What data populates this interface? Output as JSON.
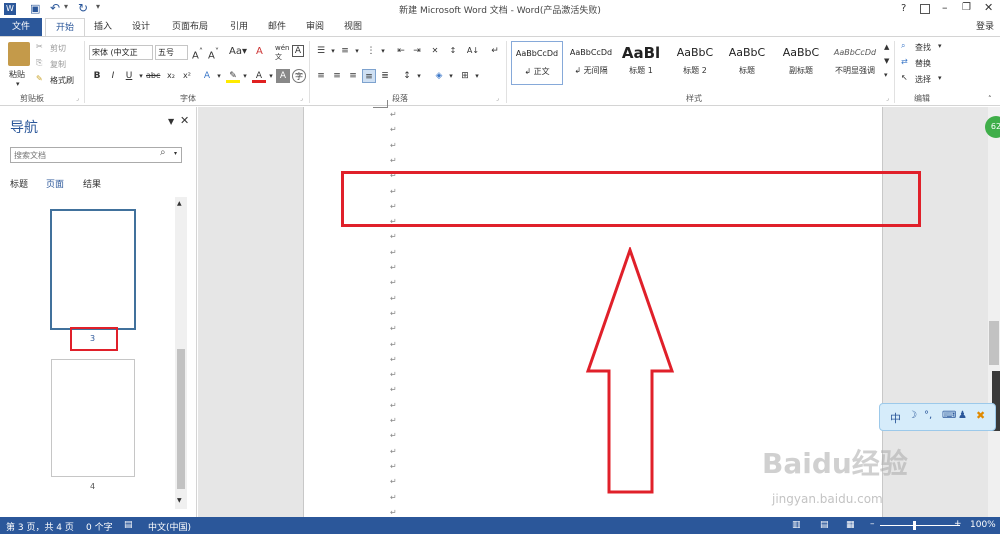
{
  "titlebar": {
    "title": "新建 Microsoft Word 文档 - Word(产品激活失败)",
    "help": "?",
    "login": "登录"
  },
  "tabs": [
    "文件",
    "开始",
    "插入",
    "设计",
    "页面布局",
    "引用",
    "邮件",
    "审阅",
    "视图"
  ],
  "ribbon": {
    "clipboard": {
      "paste": "粘贴",
      "cut": "剪切",
      "copy": "复制",
      "format_painter": "格式刷",
      "label": "剪贴板"
    },
    "font": {
      "font_name": "宋体 (中文正",
      "font_size": "五号",
      "label": "字体"
    },
    "paragraph": {
      "label": "段落"
    },
    "styles": {
      "label": "样式",
      "items": [
        {
          "preview": "AaBbCcDd",
          "name": "↲ 正文"
        },
        {
          "preview": "AaBbCcDd",
          "name": "↲ 无间隔"
        },
        {
          "preview": "AaBl",
          "name": "标题 1"
        },
        {
          "preview": "AaBbC",
          "name": "标题 2"
        },
        {
          "preview": "AaBbC",
          "name": "标题"
        },
        {
          "preview": "AaBbC",
          "name": "副标题"
        },
        {
          "preview": "AaBbCcDd",
          "name": "不明显强调"
        }
      ]
    },
    "editing": {
      "find": "查找",
      "replace": "替换",
      "select": "选择",
      "label": "编辑"
    }
  },
  "nav": {
    "title": "导航",
    "search_placeholder": "搜索文档",
    "tabs": [
      "标题",
      "页面",
      "结果"
    ],
    "thumbnails": [
      {
        "label": "3"
      },
      {
        "label": "4"
      }
    ]
  },
  "status": {
    "page": "第 3 页，共 4 页",
    "words": "0 个字",
    "lang": "中文(中国)",
    "zoom": "100%"
  },
  "overlay": {
    "ime_text": "中",
    "watermark": "Baidu经验",
    "watermark_url": "jingyan.baidu.com",
    "badge": "62"
  }
}
